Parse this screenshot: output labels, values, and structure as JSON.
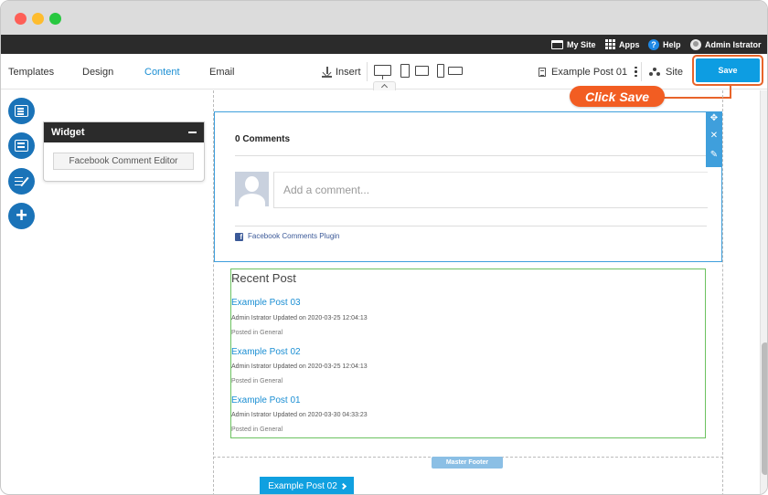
{
  "window": {
    "traffic_lights": [
      "close",
      "minimize",
      "maximize"
    ],
    "colors": {
      "close": "#fe5f57",
      "minimize": "#febc2e",
      "maximize": "#28c840"
    }
  },
  "admin_bar": {
    "my_site": "My Site",
    "apps": "Apps",
    "help": "Help",
    "user": "Admin Istrator"
  },
  "toolbar": {
    "tabs": [
      {
        "label": "Templates",
        "active": false
      },
      {
        "label": "Design",
        "active": false
      },
      {
        "label": "Content",
        "active": true
      },
      {
        "label": "Email",
        "active": false
      }
    ],
    "insert": "Insert",
    "devices": [
      "desktop-icon",
      "tablet-landscape-icon",
      "mobile-icon"
    ],
    "page_name": "Example Post 01",
    "site": "Site",
    "save": "Save",
    "accent": "#0d9de2"
  },
  "callout": {
    "text": "Click Save",
    "color": "#f25d22"
  },
  "sidebar": {
    "buttons": [
      "layout-icon",
      "content-block-icon",
      "edit-list-icon",
      "add-icon"
    ]
  },
  "widget_panel": {
    "title": "Widget",
    "item": "Facebook Comment Editor"
  },
  "comments": {
    "count_label": "0 Comments",
    "placeholder": "Add a comment...",
    "plugin_label": "Facebook Comments Plugin"
  },
  "recent_post": {
    "title": "Recent Post",
    "posts": [
      {
        "title": "Example Post 03",
        "meta": "Admin Istrator Updated on 2020-03-25 12:04:13",
        "category": "Posted in General"
      },
      {
        "title": "Example Post 02",
        "meta": "Admin Istrator Updated on 2020-03-25 12:04:13",
        "category": "Posted in General"
      },
      {
        "title": "Example Post 01",
        "meta": "Admin Istrator Updated on 2020-03-30 04:33:23",
        "category": "Posted in General"
      }
    ]
  },
  "footer": {
    "master_footer": "Master Footer",
    "next_button": "Example Post 02"
  }
}
